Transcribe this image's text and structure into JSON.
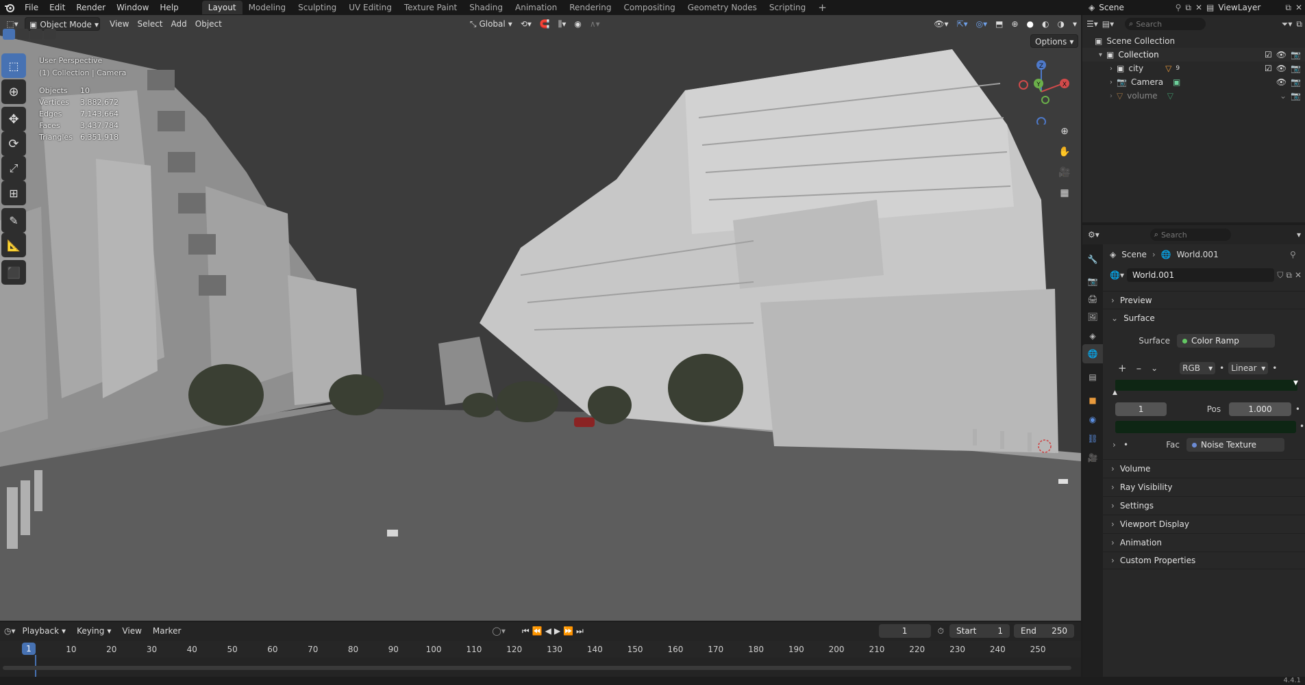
{
  "topbar": {
    "menus": [
      "File",
      "Edit",
      "Render",
      "Window",
      "Help"
    ],
    "workspaces": [
      "Layout",
      "Modeling",
      "Sculpting",
      "UV Editing",
      "Texture Paint",
      "Shading",
      "Animation",
      "Rendering",
      "Compositing",
      "Geometry Nodes",
      "Scripting"
    ],
    "active_workspace": "Layout",
    "add_tab": "+",
    "scene": "Scene",
    "view_layer": "ViewLayer"
  },
  "viewport": {
    "mode": "Object Mode",
    "menus": [
      "View",
      "Select",
      "Add",
      "Object"
    ],
    "orientation": "Global",
    "options": "Options",
    "overlay_title": "User Perspective",
    "overlay_subtitle": "(1) Collection | Camera",
    "stats": [
      {
        "label": "Objects",
        "value": "10"
      },
      {
        "label": "Vertices",
        "value": "3,882,672"
      },
      {
        "label": "Edges",
        "value": "7,143,664"
      },
      {
        "label": "Faces",
        "value": "3,437,784"
      },
      {
        "label": "Triangles",
        "value": "6,351,918"
      }
    ],
    "gizmo": {
      "x": "X",
      "y": "Y",
      "z": "Z"
    }
  },
  "outliner": {
    "search_placeholder": "Search",
    "root": "Scene Collection",
    "items": [
      {
        "label": "Collection",
        "level": 1
      },
      {
        "label": "city",
        "level": 2
      },
      {
        "label": "Camera",
        "level": 2
      },
      {
        "label": "volume",
        "level": 2
      }
    ],
    "city_count": "9"
  },
  "properties": {
    "search_placeholder": "Search",
    "breadcrumb": [
      "Scene",
      "World.001"
    ],
    "world_name": "World.001",
    "panels_top": [
      "Preview",
      "Surface"
    ],
    "surface_label": "Surface",
    "surface_value": "Color Ramp",
    "ramp_mode": "RGB",
    "ramp_interp": "Linear",
    "ramp_index": "1",
    "pos_label": "Pos",
    "pos_value": "1.000",
    "fac_label": "Fac",
    "fac_value": "Noise Texture",
    "panels_bottom": [
      "Volume",
      "Ray Visibility",
      "Settings",
      "Viewport Display",
      "Animation",
      "Custom Properties"
    ]
  },
  "timeline": {
    "menus": [
      "Playback",
      "Keying",
      "View",
      "Marker"
    ],
    "current_frame": "1",
    "start_label": "Start",
    "start": "1",
    "end_label": "End",
    "end": "250",
    "ticks": [
      "1",
      "10",
      "20",
      "30",
      "40",
      "50",
      "60",
      "70",
      "80",
      "90",
      "100",
      "110",
      "120",
      "130",
      "140",
      "150",
      "160",
      "170",
      "180",
      "190",
      "200",
      "210",
      "220",
      "230",
      "240",
      "250"
    ]
  },
  "status": {
    "version": "4.4.1"
  },
  "colors": {
    "accent": "#4772b3",
    "active_tool": "#4772b3",
    "ramp_dark": "#0e2614",
    "socket_green": "#63c763",
    "socket_blue": "#6c8cd5"
  }
}
